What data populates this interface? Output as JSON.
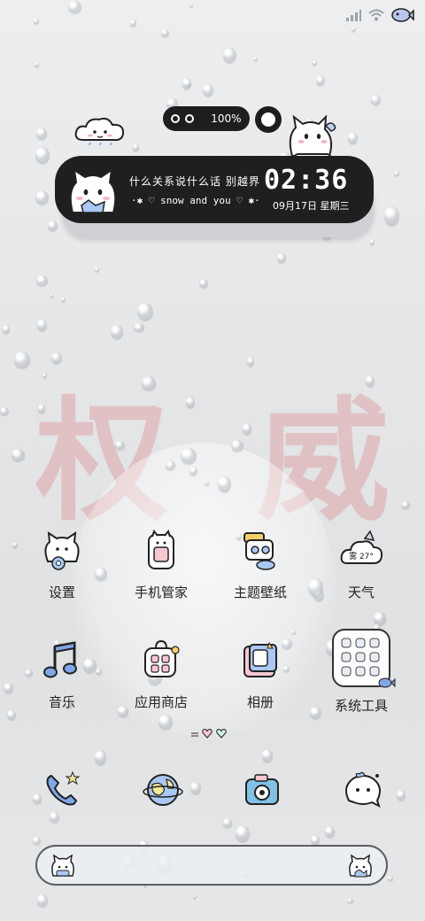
{
  "status_bar": {
    "icons": [
      "signal-icon",
      "wifi-icon",
      "fish-battery-icon"
    ]
  },
  "widget": {
    "battery_text": "100%",
    "line1": "什么关系说什么话 别越界",
    "line2": "·✱ ♡ snow and you ♡ ✱·",
    "time": "02:36",
    "date": "09月17日 星期三"
  },
  "apps": [
    {
      "label": "设置",
      "icon": "gear-cat-icon"
    },
    {
      "label": "手机管家",
      "icon": "phone-manager-icon"
    },
    {
      "label": "主题壁纸",
      "icon": "theme-wallpaper-icon"
    },
    {
      "label": "天气",
      "icon": "weather-icon",
      "badge": "雾 27°"
    },
    {
      "label": "音乐",
      "icon": "music-note-icon"
    },
    {
      "label": "应用商店",
      "icon": "app-store-icon"
    },
    {
      "label": "相册",
      "icon": "gallery-icon"
    },
    {
      "label": "系统工具",
      "icon": "system-tools-folder-icon"
    }
  ],
  "dock": [
    "phone-icon",
    "browser-globe-icon",
    "camera-icon",
    "messages-icon"
  ],
  "search_bar": {
    "left_icon": "cat-icon",
    "right_icon": "cat-icon"
  },
  "colors": {
    "widget_bg": "#1e1f21",
    "label": "#222222",
    "accent_blue": "#3f5fa8"
  }
}
